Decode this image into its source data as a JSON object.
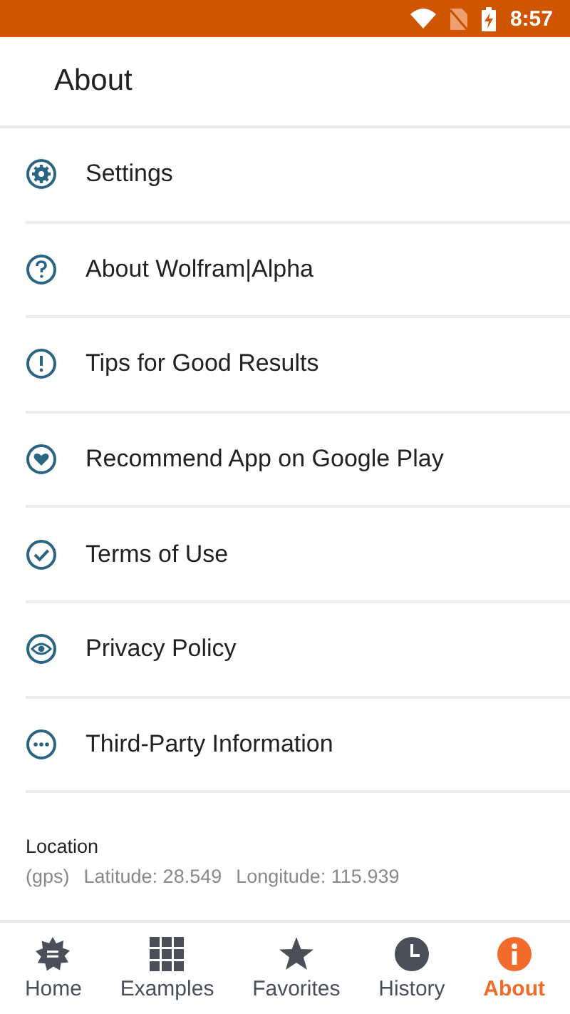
{
  "status_bar": {
    "time": "8:57"
  },
  "header": {
    "title": "About"
  },
  "menu": [
    {
      "label": "Settings"
    },
    {
      "label": "About Wolfram|Alpha"
    },
    {
      "label": "Tips for Good Results"
    },
    {
      "label": "Recommend App on Google Play"
    },
    {
      "label": "Terms of Use"
    },
    {
      "label": "Privacy Policy"
    },
    {
      "label": "Third-Party Information"
    }
  ],
  "location": {
    "title": "Location",
    "source": "(gps)",
    "latitude": "Latitude: 28.549",
    "longitude": "Longitude: 115.939"
  },
  "tabs": [
    {
      "label": "Home",
      "selected": false
    },
    {
      "label": "Examples",
      "selected": false
    },
    {
      "label": "Favorites",
      "selected": false
    },
    {
      "label": "History",
      "selected": false
    },
    {
      "label": "About",
      "selected": true
    }
  ]
}
